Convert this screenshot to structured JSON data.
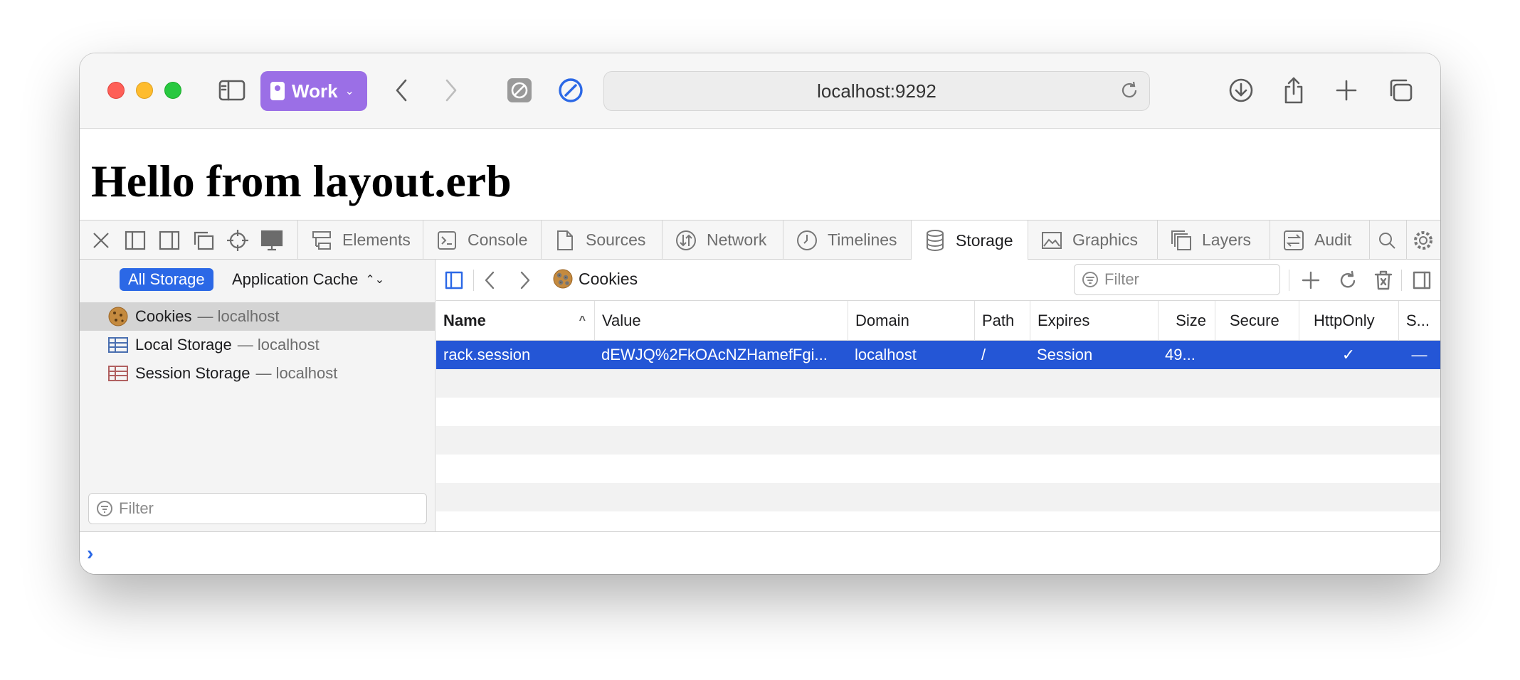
{
  "browser": {
    "profile_label": "Work",
    "address": "localhost:9292"
  },
  "page": {
    "heading": "Hello from layout.erb"
  },
  "devtools": {
    "tabs": [
      {
        "label": "Elements",
        "icon": "elements-icon"
      },
      {
        "label": "Console",
        "icon": "console-icon"
      },
      {
        "label": "Sources",
        "icon": "sources-icon"
      },
      {
        "label": "Network",
        "icon": "network-icon"
      },
      {
        "label": "Timelines",
        "icon": "timelines-icon"
      },
      {
        "label": "Storage",
        "icon": "storage-icon",
        "active": true
      },
      {
        "label": "Graphics",
        "icon": "graphics-icon"
      },
      {
        "label": "Layers",
        "icon": "layers-icon"
      },
      {
        "label": "Audit",
        "icon": "audit-icon"
      }
    ],
    "sidebar": {
      "scope_all": "All Storage",
      "scope_cache": "Application Cache",
      "items": [
        {
          "label": "Cookies",
          "sub": "— localhost",
          "icon": "cookie-icon",
          "selected": true
        },
        {
          "label": "Local Storage",
          "sub": "— localhost",
          "icon": "table-icon"
        },
        {
          "label": "Session Storage",
          "sub": "— localhost",
          "icon": "table-icon"
        }
      ],
      "filter_placeholder": "Filter"
    },
    "content": {
      "breadcrumb": "Cookies",
      "filter_placeholder": "Filter",
      "columns": [
        "Name",
        "Value",
        "Domain",
        "Path",
        "Expires",
        "Size",
        "Secure",
        "HttpOnly",
        "S..."
      ],
      "rows": [
        {
          "name": "rack.session",
          "value": "dEWJQ%2FkOAcNZHamefFgi...",
          "domain": "localhost",
          "path": "/",
          "expires": "Session",
          "size": "49...",
          "secure": "",
          "httponly": "✓",
          "samesite": "—"
        }
      ]
    },
    "console_prompt": "›"
  },
  "colors": {
    "accent": "#2b68e6",
    "selected_row": "#2456d6",
    "profile": "#9b6fe6"
  }
}
